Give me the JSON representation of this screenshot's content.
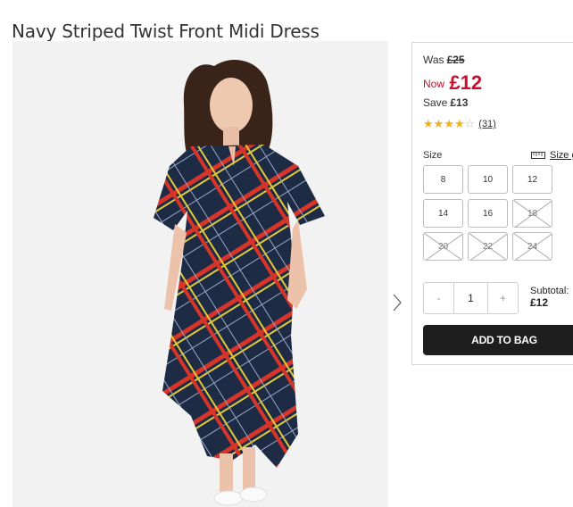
{
  "product": {
    "title": "Navy Striped Twist Front Midi Dress"
  },
  "pricing": {
    "was_label": "Was",
    "was_price": "£25",
    "now_label": "Now",
    "now_price": "£12",
    "save_label": "Save",
    "save_amount": "£13"
  },
  "rating": {
    "stars": 4,
    "out_of": 5,
    "review_count": "(31)"
  },
  "size": {
    "label": "Size",
    "guide_label": "Size g",
    "options": [
      {
        "label": "8",
        "available": true
      },
      {
        "label": "10",
        "available": true
      },
      {
        "label": "12",
        "available": true
      },
      {
        "label": "14",
        "available": true
      },
      {
        "label": "16",
        "available": true
      },
      {
        "label": "18",
        "available": false
      },
      {
        "label": "20",
        "available": false
      },
      {
        "label": "22",
        "available": false
      },
      {
        "label": "24",
        "available": false
      }
    ]
  },
  "quantity": {
    "minus": "-",
    "value": "1",
    "plus": "+"
  },
  "subtotal": {
    "label": "Subtotal:",
    "value": "£12"
  },
  "cta": {
    "add_to_bag": "ADD TO BAG"
  },
  "icons": {
    "next": "chevron-right-icon",
    "ruler": "ruler-icon",
    "star": "star-icon"
  },
  "colors": {
    "sale_red": "#c8102e",
    "star_gold": "#f2b01e",
    "button_dark": "#1e1e1e"
  }
}
